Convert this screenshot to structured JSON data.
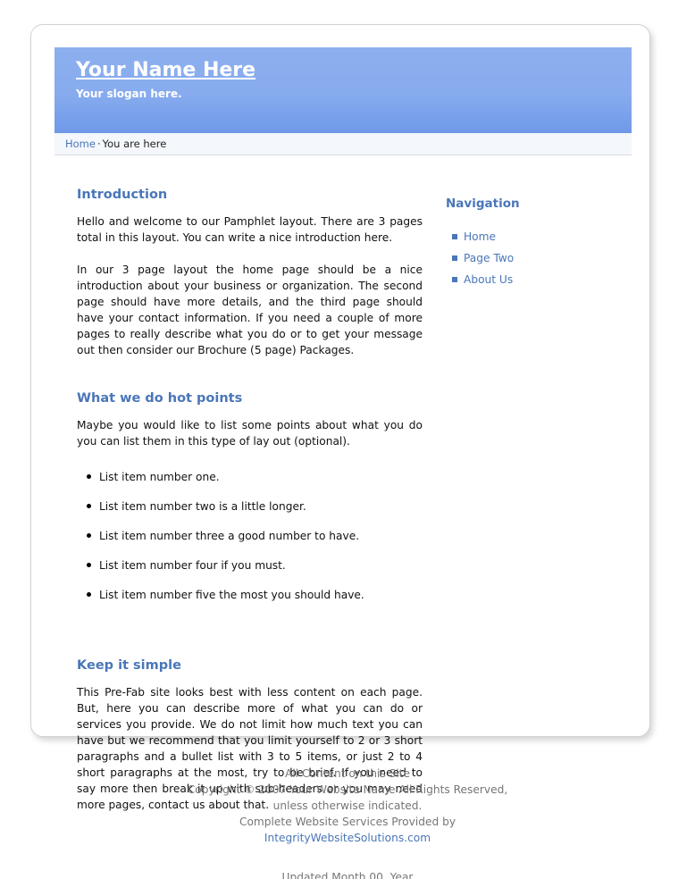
{
  "header": {
    "site_title": "Your Name Here",
    "slogan": "Your slogan here."
  },
  "breadcrumb": {
    "home_label": "Home",
    "separator": "·",
    "current": "You are here"
  },
  "main": {
    "sections": [
      {
        "heading": "Introduction",
        "paragraphs": [
          "Hello and welcome to our Pamphlet layout. There are 3 pages total in this layout. You can write a nice introduction here.",
          "In our 3 page layout the home page should be a nice introduction about your business or organization. The second page should have more details, and the third page should have your contact information. If you need a couple of more pages to really describe what you do or to get your message out then consider our Brochure (5 page) Packages."
        ]
      },
      {
        "heading": "What we do hot points",
        "paragraphs": [
          "Maybe you would like to list some points about what you do you can list them in this type of lay out (optional)."
        ],
        "list_items": [
          "List item number one.",
          "List item number two is a little longer.",
          "List item number three a good number to have.",
          "List item number four if you must.",
          "List item number five the most you should have."
        ]
      },
      {
        "heading": "Keep it simple",
        "paragraphs": [
          "This Pre-Fab site looks best with less content on each page. But, here you can describe more of what you can do or services you provide. We do not limit how much text you can have but we recommend that you limit yourself to 2 or 3 short paragraphs and a bullet list with 3 to 5 items, or just 2 to 4 short paragraphs at the most, try to be brief. If you need to say more then break it up with sub-headers or you may need more pages, contact us about that."
        ]
      }
    ]
  },
  "sidebar": {
    "heading": "Navigation",
    "items": [
      {
        "label": "Home"
      },
      {
        "label": "Page Two"
      },
      {
        "label": "About Us"
      }
    ]
  },
  "footer": {
    "line1": "All Content on this Site",
    "line2": "Copyright © 2007 Your Website Name All Rights Reserved,",
    "line3": "unless otherwise indicated.",
    "line4": "Complete Website Services Provided by",
    "link": "IntegrityWebsiteSolutions.com",
    "updated": "Updated Month 00, Year"
  },
  "colors": {
    "accent": "#4a76b8",
    "banner_top": "#8cafee",
    "banner_bottom": "#6e99e9",
    "crumb_bg": "#f4f7fb",
    "footer_text": "#767676"
  }
}
